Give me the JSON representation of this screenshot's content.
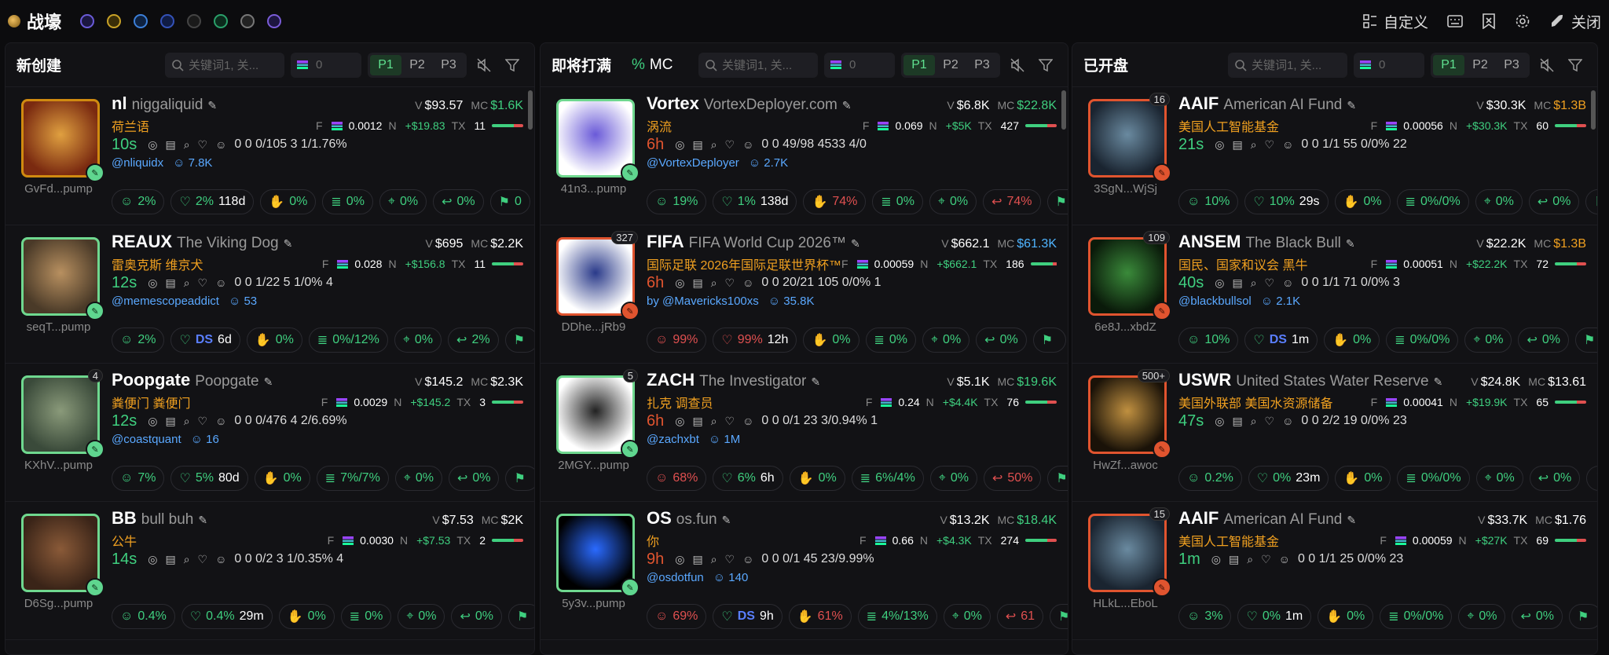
{
  "app": {
    "title": "战壕"
  },
  "topbar": {
    "customize": "自定义",
    "close": "关闭"
  },
  "columns": [
    {
      "title": "新创建",
      "mc_flag": "",
      "mc_label": "",
      "search_placeholder": "关键词1, 关...",
      "min_value": "0",
      "pages": [
        "P1",
        "P2",
        "P3"
      ],
      "cards": [
        {
          "symbol": "nl",
          "name": "niggaliquid",
          "v": "$93.57",
          "mc": "$1.6K",
          "mc_color": "green",
          "cn": "荷兰语",
          "f": "0.0012",
          "n": "+$19.83",
          "tx": "11",
          "age": "10s",
          "age_color": "green",
          "stats": "0   0   0/105   3   1/1.76%",
          "handle": "@nliquidx",
          "followers": "7.8K",
          "addr": "GvFd...pump",
          "border": "yellow",
          "count": "",
          "pills": [
            [
              "2%",
              ""
            ],
            [
              "2%",
              "118d"
            ],
            [
              "0%",
              ""
            ],
            [
              "0%",
              ""
            ],
            [
              "0%",
              ""
            ],
            [
              "0%",
              ""
            ],
            [
              "0",
              ""
            ]
          ]
        },
        {
          "symbol": "REAUX",
          "name": "The Viking Dog",
          "v": "$695",
          "mc": "$2.2K",
          "mc_color": "white",
          "cn": "雷奥克斯 维京犬",
          "f": "0.028",
          "n": "+$156.8",
          "tx": "11",
          "age": "12s",
          "age_color": "green",
          "stats": "0   0   1/22   5   1/0%   4",
          "handle": "@memescopeaddict",
          "followers": "53",
          "addr": "seqT...pump",
          "border": "green",
          "count": "",
          "pills": [
            [
              "2%",
              ""
            ],
            [
              "DS",
              "6d"
            ],
            [
              "0%",
              ""
            ],
            [
              "0%/12%",
              ""
            ],
            [
              "0%",
              ""
            ],
            [
              "2%",
              ""
            ],
            [
              "",
              ""
            ]
          ]
        },
        {
          "symbol": "Poopgate",
          "name": "Poopgate",
          "v": "$145.2",
          "mc": "$2.3K",
          "mc_color": "white",
          "cn": "粪便门 粪便门",
          "f": "0.0029",
          "n": "+$145.2",
          "tx": "3",
          "age": "12s",
          "age_color": "green",
          "stats": "0   0   0/476   4   2/6.69%",
          "handle": "@coastquant",
          "followers": "16",
          "addr": "KXhV...pump",
          "border": "green",
          "count": "4",
          "pills": [
            [
              "7%",
              ""
            ],
            [
              "5%",
              "80d"
            ],
            [
              "0%",
              ""
            ],
            [
              "7%/7%",
              ""
            ],
            [
              "0%",
              ""
            ],
            [
              "0%",
              ""
            ],
            [
              "",
              ""
            ]
          ]
        },
        {
          "symbol": "BB",
          "name": "bull buh",
          "v": "$7.53",
          "mc": "$2K",
          "mc_color": "white",
          "cn": "公牛",
          "f": "0.0030",
          "n": "+$7.53",
          "tx": "2",
          "age": "14s",
          "age_color": "green",
          "stats": "0   0   0/2   3   1/0.35%   4",
          "handle": "",
          "followers": "",
          "addr": "D6Sg...pump",
          "border": "green",
          "count": "",
          "pills": [
            [
              "0.4%",
              ""
            ],
            [
              "0.4%",
              "29m"
            ],
            [
              "0%",
              ""
            ],
            [
              "0%",
              ""
            ],
            [
              "0%",
              ""
            ],
            [
              "0%",
              ""
            ],
            [
              "",
              ""
            ]
          ]
        }
      ]
    },
    {
      "title": "即将打满",
      "mc_flag": "%",
      "mc_label": "MC",
      "search_placeholder": "关键词1, 关...",
      "min_value": "0",
      "pages": [
        "P1",
        "P2",
        "P3"
      ],
      "cards": [
        {
          "symbol": "Vortex",
          "name": "VortexDeployer.com",
          "v": "$6.8K",
          "mc": "$22.8K",
          "mc_color": "green",
          "cn": "涡流",
          "f": "0.069",
          "n": "+$5K",
          "tx": "427",
          "age": "6h",
          "age_color": "red",
          "stats": "0   0   49/98   4533   4/0",
          "handle": "@VortexDeployer",
          "followers": "2.7K",
          "addr": "41n3...pump",
          "border": "green",
          "count": "",
          "pills": [
            [
              "19%",
              ""
            ],
            [
              "1%",
              "138d"
            ],
            [
              "74%",
              ""
            ],
            [
              "0%",
              ""
            ],
            [
              "0%",
              ""
            ],
            [
              "74%",
              ""
            ],
            [
              "",
              ""
            ]
          ]
        },
        {
          "symbol": "FIFA",
          "name": "FIFA World Cup 2026™",
          "v": "$662.1",
          "mc": "$61.3K",
          "mc_color": "blue",
          "cn": "国际足联 2026年国际足联世界杯™",
          "f": "0.00059",
          "n": "+$662.1",
          "tx": "186",
          "age": "6h",
          "age_color": "red",
          "stats": "0   0   20/21   105   0/0%   1",
          "handle": "by @Mavericks100xs",
          "followers": "35.8K",
          "addr": "DDhe...jRb9",
          "border": "red",
          "count": "327",
          "pills": [
            [
              "99%",
              ""
            ],
            [
              "99%",
              "12h"
            ],
            [
              "0%",
              ""
            ],
            [
              "0%",
              ""
            ],
            [
              "0%",
              ""
            ],
            [
              "0%",
              ""
            ],
            [
              "",
              ""
            ]
          ]
        },
        {
          "symbol": "ZACH",
          "name": "The Investigator",
          "v": "$5.1K",
          "mc": "$19.6K",
          "mc_color": "green",
          "cn": "扎克 调查员",
          "f": "0.24",
          "n": "+$4.4K",
          "tx": "76",
          "age": "6h",
          "age_color": "red",
          "stats": "0   0   0/1   23   3/0.94%   1",
          "handle": "@zachxbt",
          "followers": "1M",
          "addr": "2MGY...pump",
          "border": "green",
          "count": "5",
          "pills": [
            [
              "68%",
              ""
            ],
            [
              "6%",
              "6h"
            ],
            [
              "0%",
              ""
            ],
            [
              "6%/4%",
              ""
            ],
            [
              "0%",
              ""
            ],
            [
              "50%",
              ""
            ],
            [
              "",
              ""
            ]
          ]
        },
        {
          "symbol": "OS",
          "name": "os.fun",
          "v": "$13.2K",
          "mc": "$18.4K",
          "mc_color": "green",
          "cn": "你",
          "f": "0.66",
          "n": "+$4.3K",
          "tx": "274",
          "age": "9h",
          "age_color": "red",
          "stats": "0   0   0/1   45   23/9.99%",
          "handle": "@osdotfun",
          "followers": "140",
          "addr": "5y3v...pump",
          "border": "green",
          "count": "",
          "pills": [
            [
              "69%",
              ""
            ],
            [
              "DS",
              "9h"
            ],
            [
              "61%",
              ""
            ],
            [
              "4%/13%",
              ""
            ],
            [
              "0%",
              ""
            ],
            [
              "61",
              ""
            ],
            [
              "",
              ""
            ]
          ]
        }
      ]
    },
    {
      "title": "已开盘",
      "mc_flag": "",
      "mc_label": "",
      "search_placeholder": "关键词1, 关...",
      "min_value": "0",
      "pages": [
        "P1",
        "P2",
        "P3"
      ],
      "cards": [
        {
          "symbol": "AAIF",
          "name": "American AI Fund",
          "v": "$30.3K",
          "mc": "$1.3B",
          "mc_color": "gold",
          "cn": "美国人工智能基金",
          "f": "0.00056",
          "n": "+$30.3K",
          "tx": "60",
          "age": "21s",
          "age_color": "green",
          "stats": "0   0   1/1   55   0/0%   22",
          "handle": "",
          "followers": "",
          "addr": "3SgN...WjSj",
          "border": "red",
          "count": "16",
          "pills": [
            [
              "10%",
              ""
            ],
            [
              "10%",
              "29s"
            ],
            [
              "0%",
              ""
            ],
            [
              "0%/0%",
              ""
            ],
            [
              "0%",
              ""
            ],
            [
              "0%",
              ""
            ],
            [
              "",
              ""
            ]
          ]
        },
        {
          "symbol": "ANSEM",
          "name": "The Black Bull",
          "v": "$22.2K",
          "mc": "$1.3B",
          "mc_color": "gold",
          "cn": "国民、国家和议会 黑牛",
          "f": "0.00051",
          "n": "+$22.2K",
          "tx": "72",
          "age": "40s",
          "age_color": "green",
          "stats": "0   0   1/1   71   0/0%   3",
          "handle": "@blackbullsol",
          "followers": "2.1K",
          "addr": "6e8J...xbdZ",
          "border": "red",
          "count": "109",
          "pills": [
            [
              "10%",
              ""
            ],
            [
              "DS",
              "1m"
            ],
            [
              "0%",
              ""
            ],
            [
              "0%/0%",
              ""
            ],
            [
              "0%",
              ""
            ],
            [
              "0%",
              ""
            ],
            [
              "",
              ""
            ]
          ]
        },
        {
          "symbol": "USWR",
          "name": "United States Water Reserve",
          "v": "$24.8K",
          "mc": "$13.61",
          "mc_color": "white",
          "cn": "美国外联部 美国水资源储备",
          "f": "0.00041",
          "n": "+$19.9K",
          "tx": "65",
          "age": "47s",
          "age_color": "green",
          "stats": "0   0   2/2   19   0/0%   23",
          "handle": "",
          "followers": "",
          "addr": "HwZf...awoc",
          "border": "red",
          "count": "500+",
          "pills": [
            [
              "0.2%",
              ""
            ],
            [
              "0%",
              "23m"
            ],
            [
              "0%",
              ""
            ],
            [
              "0%/0%",
              ""
            ],
            [
              "0%",
              ""
            ],
            [
              "0%",
              ""
            ],
            [
              "",
              ""
            ]
          ]
        },
        {
          "symbol": "AAIF",
          "name": "American AI Fund",
          "v": "$33.7K",
          "mc": "$1.76",
          "mc_color": "white",
          "cn": "美国人工智能基金",
          "f": "0.00059",
          "n": "+$27K",
          "tx": "69",
          "age": "1m",
          "age_color": "green",
          "stats": "0   0   1/1   25   0/0%   23",
          "handle": "",
          "followers": "",
          "addr": "HLkL...EboL",
          "border": "red",
          "count": "15",
          "pills": [
            [
              "3%",
              ""
            ],
            [
              "0%",
              "1m"
            ],
            [
              "0%",
              ""
            ],
            [
              "0%/0%",
              ""
            ],
            [
              "0%",
              ""
            ],
            [
              "0%",
              ""
            ],
            [
              "",
              ""
            ]
          ]
        }
      ]
    }
  ]
}
